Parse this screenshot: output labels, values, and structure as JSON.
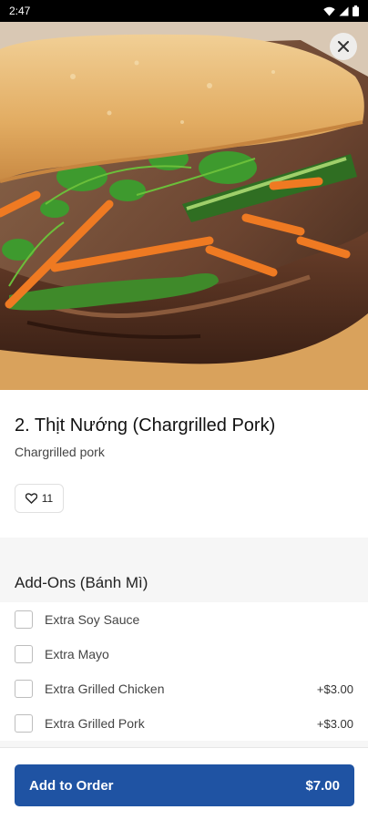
{
  "status_bar": {
    "time": "2:47"
  },
  "item": {
    "title": "2. Thịt Nướng (Chargrilled Pork)",
    "description": "Chargrilled pork",
    "likes": "11"
  },
  "addons": {
    "header": "Add-Ons (Bánh Mì)",
    "options": [
      {
        "label": "Extra Soy Sauce",
        "price": ""
      },
      {
        "label": "Extra Mayo",
        "price": ""
      },
      {
        "label": "Extra Grilled Chicken",
        "price": "+$3.00"
      },
      {
        "label": "Extra Grilled Pork",
        "price": "+$3.00"
      }
    ]
  },
  "order": {
    "button_label": "Add to Order",
    "total": "$7.00"
  },
  "colors": {
    "accent": "#1f53a3",
    "status_bar": "#000000"
  }
}
